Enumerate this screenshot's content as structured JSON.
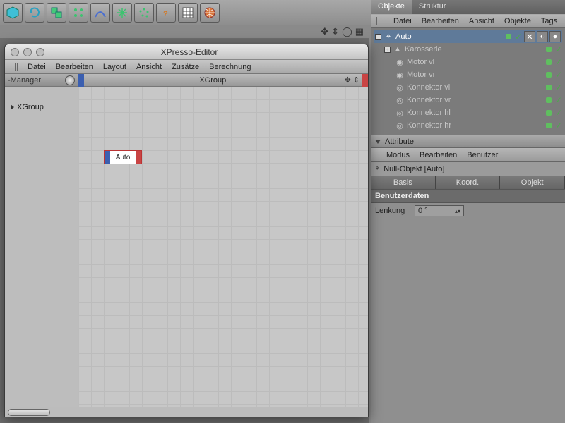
{
  "toolbar_icons": [
    "cube",
    "undo",
    "cube-group",
    "array",
    "deformer",
    "expand",
    "particles",
    "help",
    "spreadsheet",
    "web"
  ],
  "nav_icons": [
    "move",
    "down",
    "circle",
    "settings"
  ],
  "right": {
    "tabs": {
      "objects": "Objekte",
      "structure": "Struktur"
    },
    "menu": [
      "Datei",
      "Bearbeiten",
      "Ansicht",
      "Objekte",
      "Tags"
    ],
    "tree": {
      "root": "Auto",
      "children": [
        "Karosserie",
        "Motor vl",
        "Motor vr",
        "Konnektor vl",
        "Konnektor vr",
        "Konnektor hl",
        "Konnektor hr"
      ]
    },
    "attr": {
      "header": "Attribute",
      "menu": [
        "Modus",
        "Bearbeiten",
        "Benutzer"
      ],
      "title": "Null-Objekt [Auto]",
      "tabs": [
        "Basis",
        "Koord.",
        "Objekt"
      ],
      "section": "Benutzerdaten",
      "row_label": "Lenkung",
      "row_value": "0 °"
    }
  },
  "xpresso": {
    "title": "XPresso-Editor",
    "menu": [
      "Datei",
      "Bearbeiten",
      "Layout",
      "Ansicht",
      "Zusätze",
      "Berechnung"
    ],
    "manager_label": "-Manager",
    "manager_item": "XGroup",
    "canvas_title": "XGroup",
    "node_label": "Auto"
  }
}
